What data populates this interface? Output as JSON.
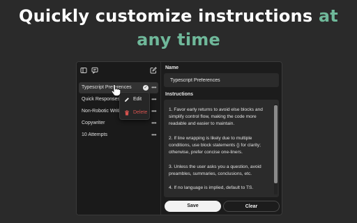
{
  "headline": {
    "line1": "Quickly customize instructions",
    "accent1": "at",
    "accent2": "any time"
  },
  "colors": {
    "accent": "#6fb89a",
    "danger": "#d9534f",
    "background": "#2a2a2a"
  },
  "sidebar": {
    "icons": [
      "sidebar-toggle-icon",
      "chat-icon",
      "new-prompt-icon"
    ],
    "items": [
      {
        "label": "Typescript Preferences",
        "selected": true,
        "active": true
      },
      {
        "label": "Quick Responses"
      },
      {
        "label": "Non-Robotic Writing"
      },
      {
        "label": "Copywriter"
      },
      {
        "label": "10 Attempts"
      }
    ],
    "more_label": "•••"
  },
  "context_menu": {
    "edit": "Edit",
    "delete": "Delete"
  },
  "form": {
    "name_label": "Name",
    "name_value": "Typescript Preferences",
    "instructions_label": "Instructions",
    "instructions_text": "1. Favor early returns to avoid else blocks and simplify control flow, making the code more readable and easier to maintain.\n\n2. If line wrapping is likely due to multiple conditions, use block statements {} for clarity; otherwise, prefer concise one-liners.\n\n3. Unless the user asks you a question, avoid preambles, summaries, conclusions, etc.\n\n4. If no language is implied, default to TS."
  },
  "buttons": {
    "save": "Save",
    "clear": "Clear"
  }
}
